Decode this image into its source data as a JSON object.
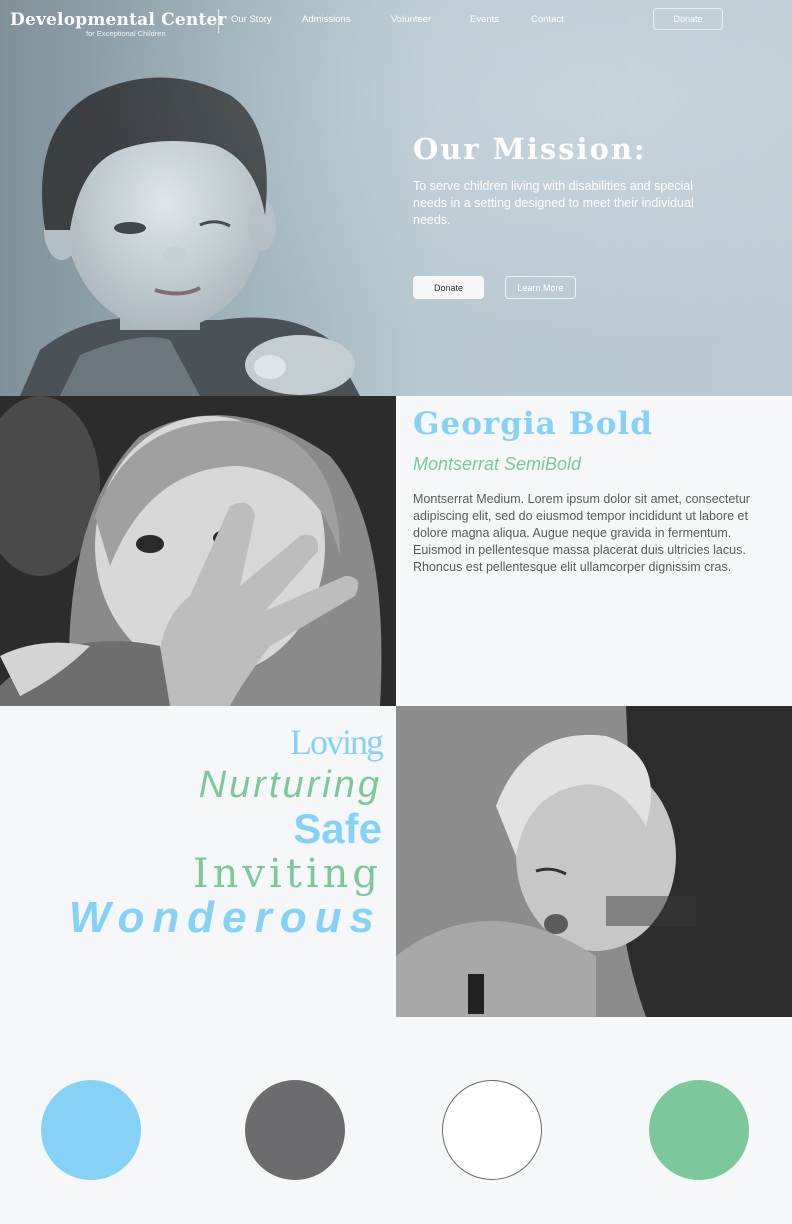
{
  "logo": {
    "name": "Developmental Center",
    "subtitle": "for Exceptional Children"
  },
  "nav": {
    "items": [
      "Our Story",
      "Admissions",
      "Volunteer",
      "Events",
      "Contact"
    ],
    "donate_label": "Donate"
  },
  "hero": {
    "title": "Our Mission:",
    "text": "To serve children living with disabilities and special needs in a setting designed to meet their individual needs.",
    "donate_label": "Donate",
    "learn_label": "Learn More"
  },
  "typography": {
    "heading": "Georgia Bold",
    "subheading": "Montserrat SemiBold",
    "body": "Montserrat Medium. Lorem ipsum dolor sit amet, consectetur adipiscing elit, sed do eiusmod tempor incididunt ut labore et dolore magna aliqua. Augue neque gravida in fermentum. Euismod in pellentesque massa placerat duis ultricies lacus. Rhoncus est pellentesque elit ullamcorper dignissim cras."
  },
  "values": [
    "Loving",
    "Nurturing",
    "Safe",
    "Inviting",
    "Wonderous"
  ],
  "palette": {
    "blue": "#85D2F6",
    "gray": "#6B6B70",
    "white": "#FFFFFF",
    "green": "#7CC89B",
    "outline": "#6B6B70"
  },
  "icons": [
    "child-photo",
    "girl-photo",
    "boy-photo"
  ]
}
